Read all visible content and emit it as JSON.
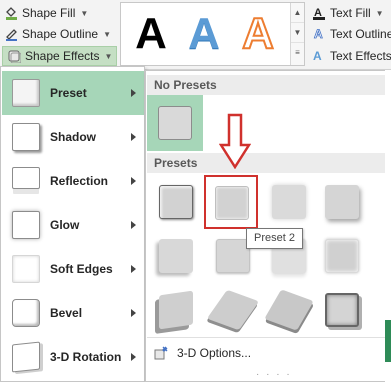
{
  "ribbon": {
    "shape_fill": "Shape Fill",
    "shape_outline": "Shape Outline",
    "shape_effects": "Shape Effects",
    "text_fill": "Text Fill",
    "text_outline": "Text Outline",
    "text_effects": "Text Effects",
    "wordart_samples": [
      "A",
      "A",
      "A"
    ]
  },
  "effects_menu": {
    "items": [
      {
        "label": "Preset"
      },
      {
        "label": "Shadow"
      },
      {
        "label": "Reflection"
      },
      {
        "label": "Glow"
      },
      {
        "label": "Soft Edges"
      },
      {
        "label": "Bevel"
      },
      {
        "label": "3-D Rotation"
      }
    ],
    "active_item": "Preset"
  },
  "preset_submenu": {
    "no_presets_header": "No Presets",
    "presets_header": "Presets",
    "tooltip": "Preset 2",
    "options_label": "3-D Options...",
    "highlighted_preset": "Preset 2",
    "preset_count": 12
  },
  "colors": {
    "accent_green": "#a6d6b8",
    "highlight_red": "#d0312d",
    "wordart_blue": "#5b9bd5",
    "wordart_orange": "#ed7d31"
  }
}
